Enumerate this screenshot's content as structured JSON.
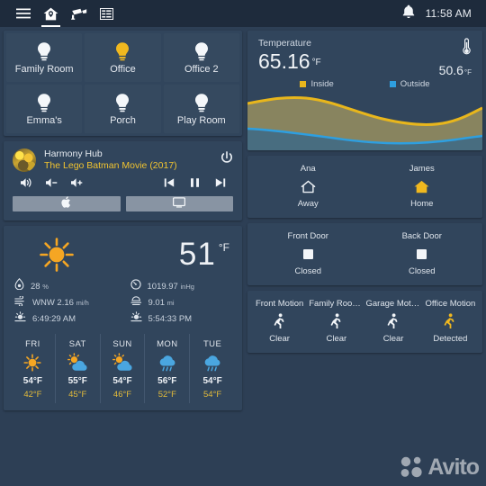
{
  "topbar": {
    "nav": [
      {
        "name": "menu-icon",
        "label": "Menu"
      },
      {
        "name": "home-icon",
        "label": "Home"
      },
      {
        "name": "camera-icon",
        "label": "Cameras"
      },
      {
        "name": "logbook-icon",
        "label": "Logbook"
      }
    ],
    "notification_icon": "bell-icon",
    "clock": "11:58 AM"
  },
  "lights": {
    "tiles": [
      {
        "label": "Family Room",
        "on": false
      },
      {
        "label": "Office",
        "on": true
      },
      {
        "label": "Office 2",
        "on": false
      },
      {
        "label": "Emma's",
        "on": false
      },
      {
        "label": "Porch",
        "on": false
      },
      {
        "label": "Play Room",
        "on": false
      }
    ]
  },
  "media": {
    "title": "Harmony Hub",
    "subtitle": "The Lego Batman Movie (2017)",
    "power_icon": "power-icon",
    "controls": [
      {
        "name": "volume-mute-button",
        "glyph": "volume-high"
      },
      {
        "name": "volume-down-button",
        "glyph": "volume-down"
      },
      {
        "name": "volume-up-button",
        "glyph": "volume-up"
      },
      {
        "name": "previous-track-button",
        "glyph": "skip-previous"
      },
      {
        "name": "pause-button",
        "glyph": "pause"
      },
      {
        "name": "next-track-button",
        "glyph": "skip-next"
      }
    ],
    "source_buttons": [
      {
        "name": "apple-tv-source-button",
        "icon": "apple-icon"
      },
      {
        "name": "tv-source-button",
        "icon": "television-icon"
      }
    ]
  },
  "weather": {
    "condition_icon": "sunny-icon",
    "temperature": "51",
    "unit": "°F",
    "details_left": [
      {
        "icon": "humidity-icon",
        "value": "28",
        "unit": "%"
      },
      {
        "icon": "wind-icon",
        "value": "WNW 2.16",
        "unit": "mi/h"
      },
      {
        "icon": "sunrise-icon",
        "value": "6:49:29 AM",
        "unit": ""
      }
    ],
    "details_right": [
      {
        "icon": "gauge-icon",
        "value": "1019.97",
        "unit": "inHg"
      },
      {
        "icon": "visibility-icon",
        "value": "9.01",
        "unit": "mi"
      },
      {
        "icon": "sunset-icon",
        "value": "5:54:33 PM",
        "unit": ""
      }
    ],
    "forecast": [
      {
        "day": "FRI",
        "icon": "sunny-icon",
        "high": "54°F",
        "low": "42°F"
      },
      {
        "day": "SAT",
        "icon": "partly-cloudy-icon",
        "high": "55°F",
        "low": "45°F"
      },
      {
        "day": "SUN",
        "icon": "partly-cloudy-icon",
        "high": "54°F",
        "low": "46°F"
      },
      {
        "day": "MON",
        "icon": "rainy-icon",
        "high": "56°F",
        "low": "52°F"
      },
      {
        "day": "TUE",
        "icon": "rainy-icon",
        "high": "54°F",
        "low": "54°F"
      }
    ]
  },
  "chart_card": {
    "title": "Temperature",
    "primary_value": "65.16",
    "primary_unit": "°F",
    "secondary_value": "50.6",
    "secondary_unit": "°F",
    "thermometer_icon": "thermometer-icon",
    "legend": [
      {
        "label": "Inside",
        "color": "#e8b61c"
      },
      {
        "label": "Outside",
        "color": "#2e9fe0"
      }
    ]
  },
  "chart_data": {
    "type": "area",
    "title": "Temperature",
    "xlabel": "",
    "ylabel": "°F",
    "ylim": [
      45,
      70
    ],
    "grid": false,
    "legend_position": "top-center",
    "x": [
      0,
      1,
      2,
      3,
      4,
      5,
      6,
      7,
      8,
      9,
      10,
      11,
      12
    ],
    "series": [
      {
        "name": "Inside",
        "color": "#e8b61c",
        "values": [
          66.4,
          67.0,
          67.4,
          67.1,
          66.3,
          65.6,
          65.1,
          64.8,
          64.6,
          64.5,
          64.6,
          65.3,
          65.16
        ]
      },
      {
        "name": "Outside",
        "color": "#2e9fe0",
        "values": [
          53.2,
          53.0,
          52.4,
          51.6,
          50.9,
          50.2,
          49.7,
          49.3,
          49.2,
          49.4,
          49.8,
          50.3,
          50.6
        ]
      }
    ]
  },
  "persons": {
    "items": [
      {
        "name": "Ana",
        "icon": "home-outline-icon",
        "state": "Away",
        "active": false
      },
      {
        "name": "James",
        "icon": "home-filled-icon",
        "state": "Home",
        "active": true
      }
    ]
  },
  "doors": {
    "items": [
      {
        "name": "Front Door",
        "icon": "door-closed-icon",
        "state": "Closed"
      },
      {
        "name": "Back Door",
        "icon": "door-closed-icon",
        "state": "Closed"
      }
    ]
  },
  "motion": {
    "items": [
      {
        "name": "Front Motion",
        "icon": "motion-sensor-icon",
        "state": "Clear",
        "active": false
      },
      {
        "name": "Family Room...",
        "icon": "motion-sensor-icon",
        "state": "Clear",
        "active": false
      },
      {
        "name": "Garage Motion",
        "icon": "motion-sensor-icon",
        "state": "Clear",
        "active": false
      },
      {
        "name": "Office Motion",
        "icon": "motion-sensor-icon",
        "state": "Detected",
        "active": true
      }
    ]
  },
  "watermark": {
    "text": "Avito"
  },
  "colors": {
    "page_background": "#2d3f55",
    "card_background": "#31455c",
    "topbar_background": "#1e2b3c",
    "accent_on": "#f0b81f",
    "text_primary": "#e6eaf0",
    "text_secondary": "#c9d2dd"
  }
}
